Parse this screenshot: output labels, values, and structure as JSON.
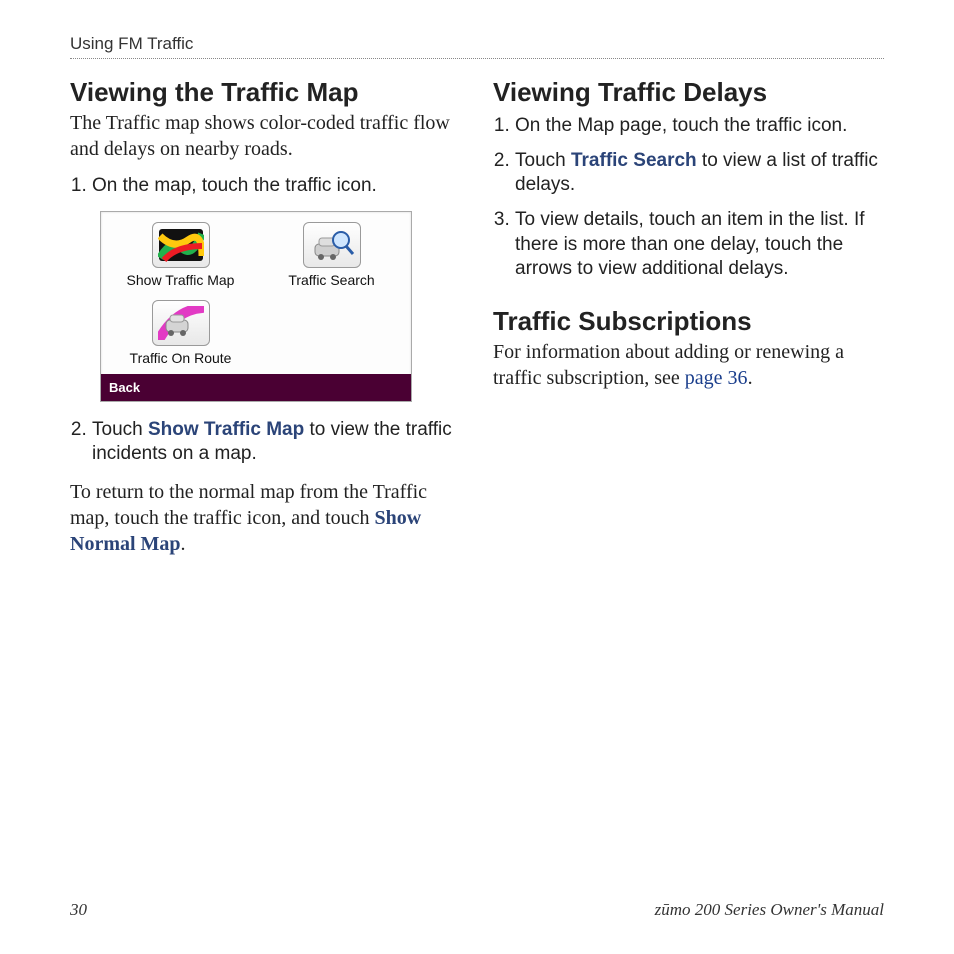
{
  "header": {
    "running": "Using FM Traffic"
  },
  "left": {
    "heading": "Viewing the Traffic Map",
    "intro": "The Traffic map shows color-coded traffic flow and delays on nearby roads.",
    "step1": "On the map, touch the traffic icon.",
    "device": {
      "btn_map": "Show Traffic Map",
      "btn_search": "Traffic Search",
      "btn_route": "Traffic On Route",
      "back": "Back"
    },
    "step2_pre": "Touch ",
    "step2_em": "Show Traffic Map",
    "step2_post": " to view the traffic incidents on a map.",
    "after_pre": "To return to the normal map from the Traffic map, touch the traffic icon, and touch ",
    "after_em": "Show Normal Map",
    "after_post": "."
  },
  "right": {
    "heading1": "Viewing Traffic Delays",
    "d_step1": "On the Map page, touch the traffic icon.",
    "d_step2_pre": "Touch ",
    "d_step2_em": "Traffic Search",
    "d_step2_post": " to view a list of traffic delays.",
    "d_step3": "To view details, touch an item in the list. If there is more than one delay, touch the arrows to view additional delays.",
    "heading2": "Traffic Subscriptions",
    "subs_pre": "For information about adding or renewing a traffic subscription, see ",
    "subs_link": "page 36",
    "subs_post": "."
  },
  "footer": {
    "page": "30",
    "title": "zūmo 200 Series Owner's Manual"
  }
}
